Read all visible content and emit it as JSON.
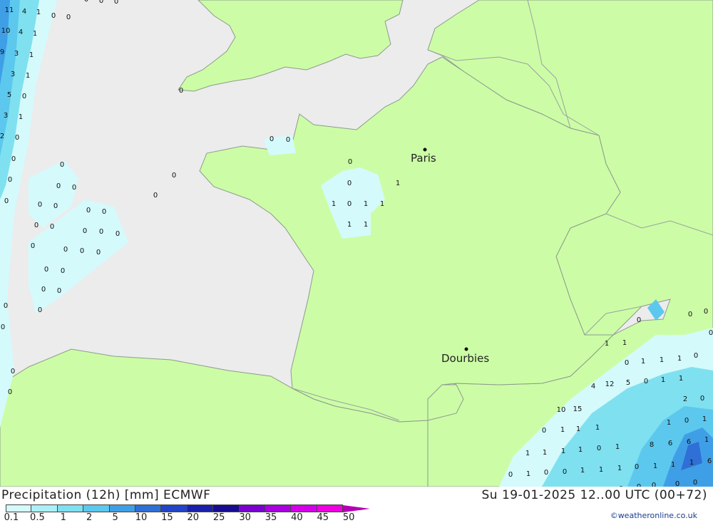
{
  "map": {
    "cities": [
      {
        "name": "Paris"
      },
      {
        "name": "Dourbies"
      }
    ],
    "colors": {
      "sea": "#ececec",
      "land": "#ccfda6",
      "border": "#9aa0a0",
      "coast": "#8d9a8d",
      "precip_01": "#d4fafc",
      "precip_05": "#aaf0f6",
      "precip_1": "#7fe0f0",
      "precip_2": "#5cc8ee",
      "precip_5": "#3f9fe6",
      "precip_10": "#2f6fd6"
    },
    "labels": [
      "11",
      "4",
      "1",
      "0",
      "10",
      "4",
      "1",
      "9",
      "3",
      "1",
      "3",
      "1",
      "5",
      "0",
      "3",
      "1",
      "2",
      "0",
      "0",
      "0",
      "0",
      "0",
      "0",
      "0",
      "0",
      "0",
      "0",
      "0",
      "0",
      "0",
      "0",
      "0",
      "0",
      "0",
      "0",
      "0",
      "0",
      "0",
      "0",
      "0",
      "0",
      "0",
      "0",
      "0",
      "0",
      "0",
      "0",
      "0",
      "0",
      "0",
      "0",
      "0",
      "0",
      "0",
      "0",
      "0",
      "0",
      "1",
      "1",
      "0",
      "1",
      "1",
      "1",
      "1",
      "0",
      "1",
      "1",
      "0",
      "0",
      "0",
      "0",
      "1",
      "1",
      "1",
      "0",
      "4",
      "12",
      "5",
      "0",
      "1",
      "1",
      "0",
      "2",
      "15",
      "10",
      "0",
      "1",
      "1",
      "1",
      "1",
      "0",
      "1",
      "6",
      "8",
      "6",
      "1",
      "1",
      "1",
      "1",
      "1",
      "0",
      "1",
      "1",
      "1",
      "1",
      "6",
      "0",
      "1",
      "0",
      "0",
      "1",
      "1",
      "1",
      "0",
      "0",
      "0",
      "0",
      "0",
      "0",
      "0"
    ]
  },
  "footer": {
    "title_left": "Precipitation (12h) [mm] ECMWF",
    "title_right": "Su 19-01-2025 12..00 UTC (00+72)",
    "credit": "©weatheronline.co.uk",
    "legend": {
      "ticks": [
        "0.1",
        "0.5",
        "1",
        "2",
        "5",
        "10",
        "15",
        "20",
        "25",
        "30",
        "35",
        "40",
        "45",
        "50"
      ],
      "colors": [
        "#d4fafc",
        "#aaf0f6",
        "#7fe0f0",
        "#5cc8ee",
        "#3f9fe6",
        "#2f6fd6",
        "#2244c8",
        "#1a20a8",
        "#180c90",
        "#7a00d0",
        "#a800e0",
        "#d400e8",
        "#f000e0",
        "#b400b4"
      ]
    }
  }
}
